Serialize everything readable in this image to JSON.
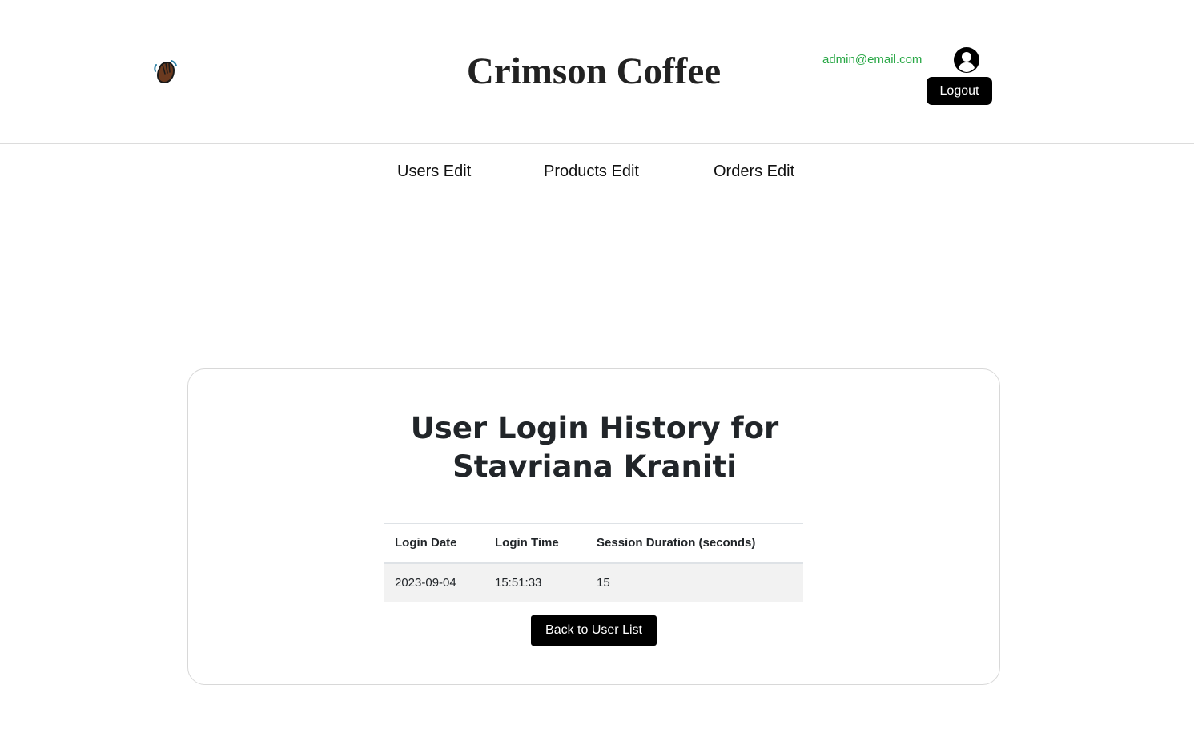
{
  "header": {
    "wave_icon": "waving-hand-icon",
    "brand": "Crimson Coffee",
    "email": "admin@email.com",
    "user_icon": "user-circle-icon",
    "logout_label": "Logout"
  },
  "nav": {
    "items": [
      {
        "label": "Users Edit"
      },
      {
        "label": "Products Edit"
      },
      {
        "label": "Orders Edit"
      }
    ]
  },
  "main": {
    "title_line1": "User Login History for",
    "title_line2": "Stavriana Kraniti",
    "table": {
      "columns": [
        "Login Date",
        "Login Time",
        "Session Duration (seconds)"
      ],
      "rows": [
        [
          "2023-09-04",
          "15:51:33",
          "15"
        ]
      ]
    },
    "back_label": "Back to User List"
  },
  "colors": {
    "email": "#28a745",
    "button_bg": "#000000",
    "row_bg": "#f2f2f2"
  }
}
